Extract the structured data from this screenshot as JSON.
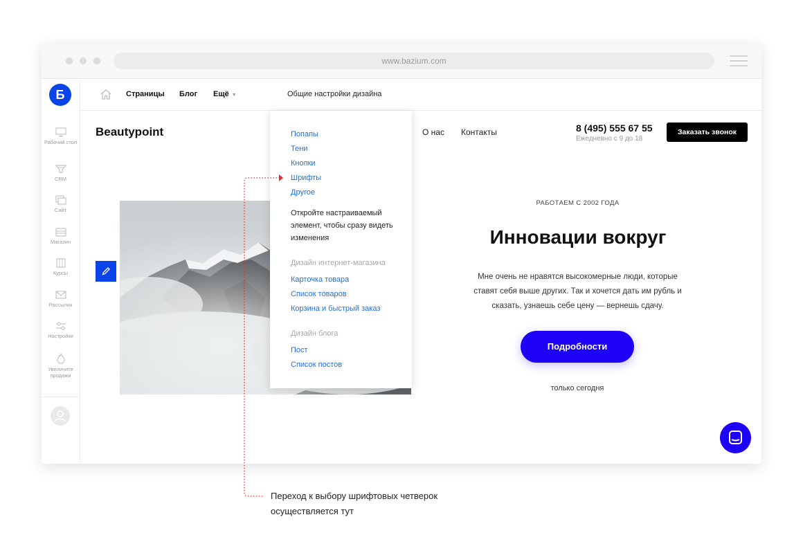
{
  "browser": {
    "url": "www.bazium.com"
  },
  "app": {
    "logo_letter": "Б",
    "sidebar": [
      {
        "label": "Рабочий стол",
        "icon": "monitor-icon"
      },
      {
        "label": "CRM",
        "icon": "funnel-icon"
      },
      {
        "label": "Сайт",
        "icon": "site-icon"
      },
      {
        "label": "Магазин",
        "icon": "shop-icon"
      },
      {
        "label": "Курсы",
        "icon": "courses-icon"
      },
      {
        "label": "Рассылки",
        "icon": "mail-icon"
      },
      {
        "label": "Настройки",
        "icon": "sliders-icon"
      },
      {
        "label": "Увеличите продажи",
        "icon": "fire-icon"
      }
    ],
    "toolbar": {
      "pages": "Страницы",
      "blog": "Блог",
      "more": "Ещё",
      "design_settings": "Общие настройки дизайна"
    }
  },
  "site": {
    "brand": "Beautypoint",
    "nav": [
      "О нас",
      "Контакты"
    ],
    "phone": "8 (495) 555 67 55",
    "hours": "Ежедневно с 9 до 18",
    "call_button": "Заказать звонок",
    "eyebrow": "РАБОТАЕМ С 2002 ГОДА",
    "hero_title": "Инновации вокруг",
    "paragraph": "Мне очень не нравятся высокомерные люди, которые ставят себя выше других. Так и хочется дать им рубль и сказать, узнаешь себе цену — вернешь сдачу.",
    "cta": "Подробности",
    "cta_sub": "только сегодня"
  },
  "dropdown": {
    "links_top": [
      "Попапы",
      "Тени",
      "Кнопки",
      "Шрифты",
      "Другое"
    ],
    "hint": "Откройте настраиваемый элемент, чтобы сразу видеть изменения",
    "shop_heading": "Дизайн интернет-магазина",
    "shop_links": [
      "Карточка товара",
      "Список товаров",
      "Корзина и быстрый заказ"
    ],
    "blog_heading": "Дизайн блога",
    "blog_links": [
      "Пост",
      "Список постов"
    ]
  },
  "annotation": {
    "line1": "Переход к выбору шрифтовых четверок",
    "line2": "осуществляется тут",
    "color": "#e0302b"
  },
  "colors": {
    "brand_blue": "#0a43e8",
    "cta": "#1d00f5",
    "link": "#1f6fd6"
  }
}
